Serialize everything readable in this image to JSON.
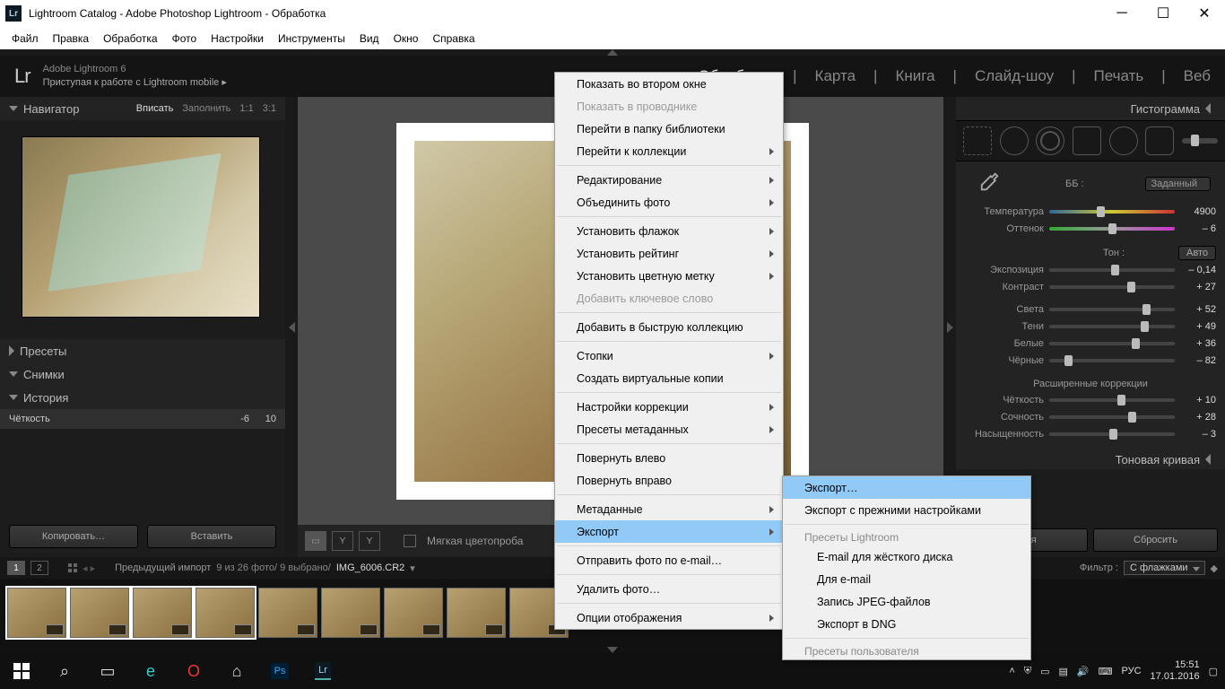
{
  "titlebar": {
    "text": "Lightroom Catalog - Adobe Photoshop Lightroom - Обработка"
  },
  "osmenu": [
    "Файл",
    "Правка",
    "Обработка",
    "Фото",
    "Настройки",
    "Инструменты",
    "Вид",
    "Окно",
    "Справка"
  ],
  "branding": {
    "line1": "Adobe Lightroom 6",
    "line2": "Приступая к работе с Lightroom mobile    ▸"
  },
  "modules": [
    "Обработка",
    "Карта",
    "Книга",
    "Слайд-шоу",
    "Печать",
    "Веб"
  ],
  "active_module": "Обработка",
  "left": {
    "navigator": "Навигатор",
    "fit": [
      "Вписать",
      "Заполнить",
      "1:1",
      "3:1"
    ],
    "panels": [
      "Пресеты",
      "Снимки",
      "История"
    ],
    "history_item": {
      "name": "Чёткость",
      "a": "-6",
      "b": "10"
    },
    "copy": "Копировать…",
    "paste": "Вставить"
  },
  "right": {
    "histogram": "Гистограмма",
    "wb_label": "ББ :",
    "wb_value": "Заданный",
    "sliders": [
      {
        "lbl": "Температура",
        "val": "4900",
        "pos": 38,
        "track": "temp"
      },
      {
        "lbl": "Оттенок",
        "val": "– 6",
        "pos": 47,
        "track": "tint"
      }
    ],
    "tone_title": "Тон :",
    "auto": "Авто",
    "tone": [
      {
        "lbl": "Экспозиция",
        "val": "– 0,14",
        "pos": 49
      },
      {
        "lbl": "Контраст",
        "val": "+ 27",
        "pos": 62
      }
    ],
    "tone2": [
      {
        "lbl": "Света",
        "val": "+ 52",
        "pos": 74
      },
      {
        "lbl": "Тени",
        "val": "+ 49",
        "pos": 73
      },
      {
        "lbl": "Белые",
        "val": "+ 36",
        "pos": 66
      },
      {
        "lbl": "Чёрные",
        "val": "– 82",
        "pos": 12
      }
    ],
    "ext_title": "Расширенные коррекции",
    "ext": [
      {
        "lbl": "Чёткость",
        "val": "+ 10",
        "pos": 54
      },
      {
        "lbl": "Сочность",
        "val": "+ 28",
        "pos": 63
      },
      {
        "lbl": "Насыщенность",
        "val": "– 3",
        "pos": 48
      }
    ],
    "tonecurve": "Тоновая кривая",
    "btn1": "ация",
    "btn2": "Сбросить"
  },
  "ctoolbar": {
    "soft": "Мягкая цветопроба"
  },
  "film": {
    "prev": "Предыдущий импорт",
    "count": "9 из 26 фото/  9 выбрано/",
    "file": "IMG_6006.CR2",
    "filter_label": "Фильтр :",
    "filter_value": "С флажками"
  },
  "ctx1": [
    {
      "t": "Показать во втором окне"
    },
    {
      "t": "Показать в проводнике",
      "dis": true
    },
    {
      "t": "Перейти в папку библиотеки"
    },
    {
      "t": "Перейти к коллекции",
      "sub": true
    },
    {
      "sep": true
    },
    {
      "t": "Редактирование",
      "sub": true
    },
    {
      "t": "Объединить фото",
      "sub": true
    },
    {
      "sep": true
    },
    {
      "t": "Установить флажок",
      "sub": true
    },
    {
      "t": "Установить рейтинг",
      "sub": true
    },
    {
      "t": "Установить цветную метку",
      "sub": true
    },
    {
      "t": "Добавить ключевое слово",
      "dis": true
    },
    {
      "sep": true
    },
    {
      "t": "Добавить в быструю коллекцию"
    },
    {
      "sep": true
    },
    {
      "t": "Стопки",
      "sub": true
    },
    {
      "t": "Создать виртуальные копии"
    },
    {
      "sep": true
    },
    {
      "t": "Настройки коррекции",
      "sub": true
    },
    {
      "t": "Пресеты метаданных",
      "sub": true
    },
    {
      "sep": true
    },
    {
      "t": "Повернуть влево"
    },
    {
      "t": "Повернуть вправо"
    },
    {
      "sep": true
    },
    {
      "t": "Метаданные",
      "sub": true
    },
    {
      "t": "Экспорт",
      "sub": true,
      "hl": true
    },
    {
      "sep": true
    },
    {
      "t": "Отправить фото по e-mail…"
    },
    {
      "sep": true
    },
    {
      "t": "Удалить фото…"
    },
    {
      "sep": true
    },
    {
      "t": "Опции отображения",
      "sub": true
    }
  ],
  "ctx2": {
    "top": [
      {
        "t": "Экспорт…",
        "hl": true
      },
      {
        "t": "Экспорт с прежними настройками"
      }
    ],
    "h1": "Пресеты Lightroom",
    "mid": [
      {
        "t": "E-mail для жёсткого диска"
      },
      {
        "t": "Для e-mail"
      },
      {
        "t": "Запись JPEG-файлов"
      },
      {
        "t": "Экспорт в DNG"
      }
    ],
    "h2": "Пресеты пользователя"
  },
  "taskbar": {
    "lang": "РУС",
    "time": "15:51",
    "date": "17.01.2016"
  }
}
